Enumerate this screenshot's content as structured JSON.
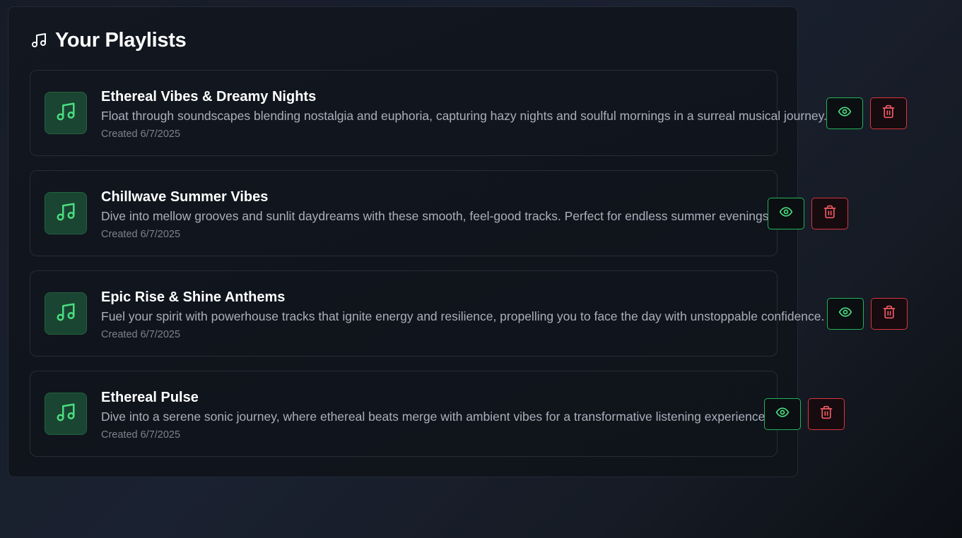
{
  "header": {
    "title": "Your Playlists",
    "icon": "music-note-icon"
  },
  "colors": {
    "accent_green": "#4ade80",
    "danger_red": "#f05a63",
    "thumb_bg": "#1a4532"
  },
  "playlists": [
    {
      "title": "Ethereal Vibes & Dreamy Nights",
      "description": "Float through soundscapes blending nostalgia and euphoria, capturing hazy nights and soulful mornings in a surreal musical journey.",
      "created": "Created 6/7/2025"
    },
    {
      "title": "Chillwave Summer Vibes",
      "description": "Dive into mellow grooves and sunlit daydreams with these smooth, feel-good tracks. Perfect for endless summer evenings.",
      "created": "Created 6/7/2025"
    },
    {
      "title": "Epic Rise & Shine Anthems",
      "description": "Fuel your spirit with powerhouse tracks that ignite energy and resilience, propelling you to face the day with unstoppable confidence.",
      "created": "Created 6/7/2025"
    },
    {
      "title": "Ethereal Pulse",
      "description": "Dive into a serene sonic journey, where ethereal beats merge with ambient vibes for a transformative listening experience.",
      "created": "Created 6/7/2025"
    }
  ],
  "actions": {
    "view_icon": "eye-icon",
    "delete_icon": "trash-icon"
  }
}
